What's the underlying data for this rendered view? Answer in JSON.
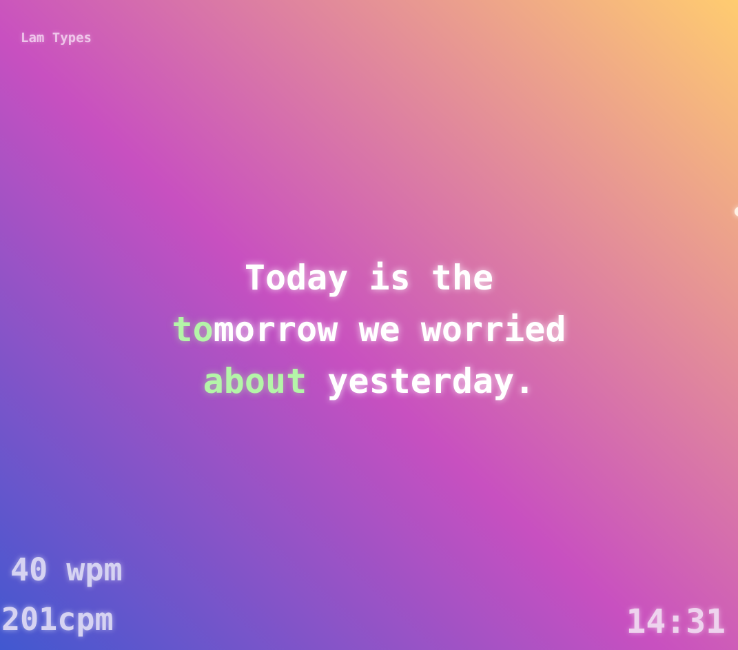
{
  "app": {
    "title": "Lam Types"
  },
  "quote": {
    "lines": [
      {
        "typed": "",
        "rest": "Today is the"
      },
      {
        "typed": "to",
        "rest": "morrow we worried"
      },
      {
        "typed": "about",
        "rest": " yesterday."
      }
    ]
  },
  "stats": {
    "wpm": "40 wpm",
    "cpm": "201cpm",
    "time": "14:31"
  },
  "colors": {
    "typed": "#b4f5a8",
    "untyped": "#ffffff",
    "gradient": [
      "#4158D0",
      "#C850C0",
      "#FFCC70"
    ]
  }
}
